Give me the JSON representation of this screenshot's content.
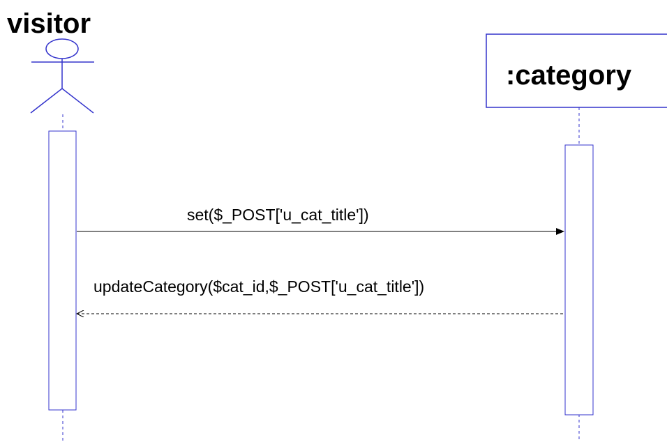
{
  "diagram": {
    "type": "sequence",
    "colors": {
      "line": "#3333cc",
      "arrow": "#000000",
      "text": "#000000",
      "box_fill": "#ffffff"
    },
    "participants": [
      {
        "id": "visitor",
        "label": "visitor",
        "kind": "actor"
      },
      {
        "id": "category",
        "label": ":category",
        "kind": "object"
      }
    ],
    "messages": [
      {
        "from": "visitor",
        "to": "category",
        "label": "set($_POST['u_cat_title'])",
        "style": "solid"
      },
      {
        "from": "category",
        "to": "visitor",
        "label": "updateCategory($cat_id,$_POST['u_cat_title'])",
        "style": "dashed-return"
      }
    ]
  }
}
